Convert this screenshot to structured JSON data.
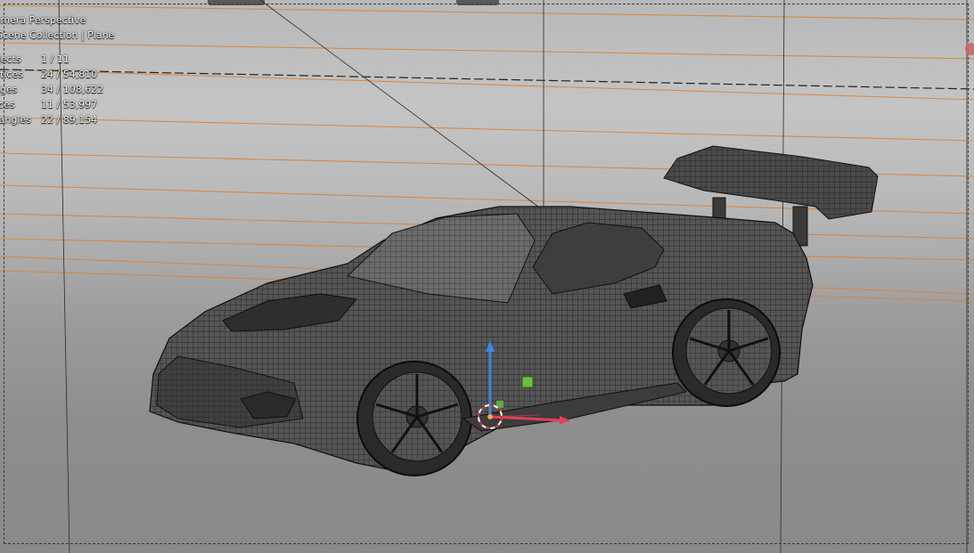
{
  "viewport": {
    "view_name": "Camera Perspective",
    "collection_path": "Scene Collection | Plane",
    "stats": [
      {
        "label": "Objects",
        "value": "1 / 11"
      },
      {
        "label": "Vertices",
        "value": "24 / 54,810"
      },
      {
        "label": "Edges",
        "value": "34 / 108,622"
      },
      {
        "label": "Faces",
        "value": "11 / 53,997"
      },
      {
        "label": "Triangles",
        "value": "22 / 89,154"
      }
    ]
  },
  "colors": {
    "background_top": "#c4c4c4",
    "background_bottom": "#8a8a8a",
    "guide_lines": "#d98a45",
    "wireframe": "#1a1a1a",
    "gizmo_x": "#e0405a",
    "gizmo_z": "#3a86e0",
    "gizmo_y": "#6ac040"
  },
  "icons": {
    "collection": "collection-icon",
    "transform_gizmo": "transform-gizmo-icon",
    "cursor": "3d-cursor-icon"
  }
}
